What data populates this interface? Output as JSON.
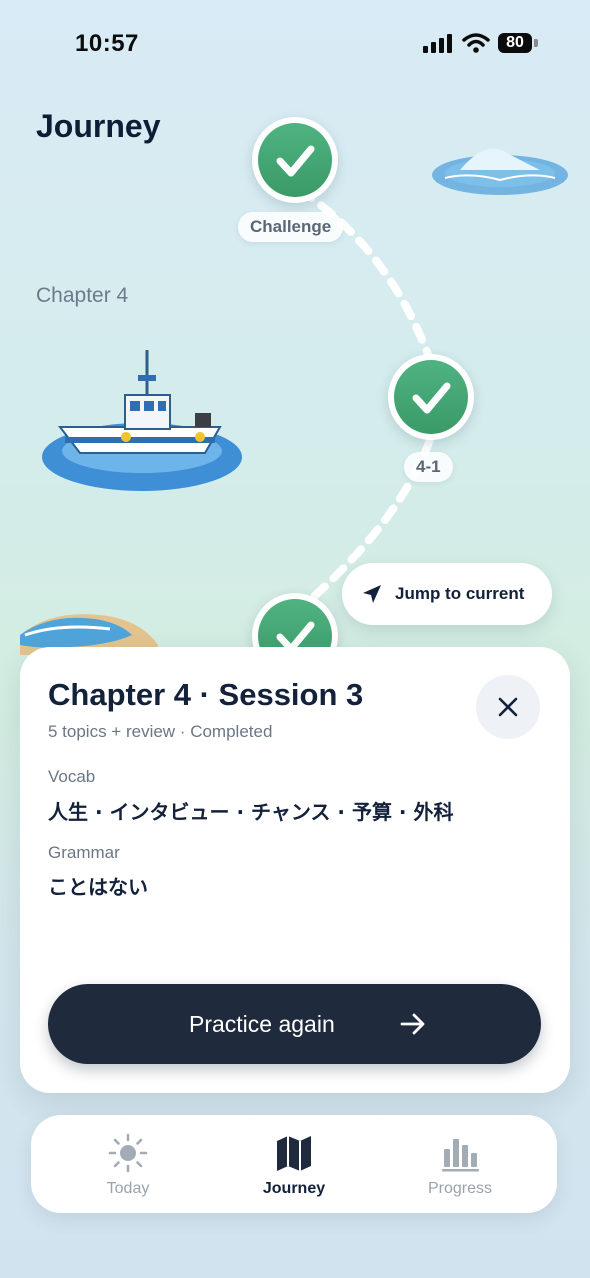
{
  "status": {
    "time": "10:57",
    "battery": "80"
  },
  "page": {
    "title": "Journey",
    "chapter_label": "Chapter 4"
  },
  "path": {
    "nodes": [
      {
        "label": "Challenge",
        "state": "completed",
        "icon": "check-icon"
      },
      {
        "label": "4-1",
        "state": "completed",
        "icon": "check-icon"
      },
      {
        "label": "",
        "state": "completed",
        "icon": "check-icon"
      }
    ],
    "jump_label": "Jump to current"
  },
  "sheet": {
    "title": "Chapter 4 · Session 3",
    "subtitle": "5 topics + review · Completed",
    "vocab_label": "Vocab",
    "vocab_value": "人生 · インタビュー · チャンス · 予算 · 外科",
    "grammar_label": "Grammar",
    "grammar_value": "ことはない",
    "cta_label": "Practice again"
  },
  "tabs": [
    {
      "label": "Today",
      "icon": "sun-icon",
      "active": false
    },
    {
      "label": "Journey",
      "icon": "map-icon",
      "active": true
    },
    {
      "label": "Progress",
      "icon": "bar-chart-icon",
      "active": false
    }
  ],
  "colors": {
    "accent_green": "#43a873",
    "dark": "#1f2a3d",
    "muted": "#6b7786"
  }
}
